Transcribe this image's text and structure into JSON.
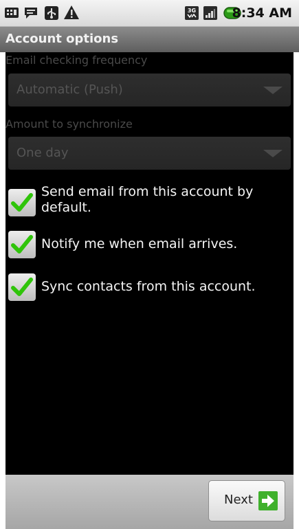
{
  "status_bar": {
    "time": "8:34 AM",
    "left_icons": [
      "keyboard-icon",
      "message-icon",
      "usb-icon",
      "warning-icon"
    ],
    "right_icons": [
      "3g-icon",
      "signal-icon",
      "battery-icon"
    ]
  },
  "title_bar": {
    "title": "Account options"
  },
  "settings": {
    "frequency": {
      "label": "Email checking frequency",
      "value": "Automatic (Push)"
    },
    "amount": {
      "label": "Amount to synchronize",
      "value": "One day"
    }
  },
  "checkboxes": [
    {
      "label_line1": "Send email from this account by",
      "label_line2": "default.",
      "checked": true
    },
    {
      "label_line1": "Notify me when email arrives.",
      "label_line2": "",
      "checked": true
    },
    {
      "label_line1": "Sync contacts from this account.",
      "label_line2": "",
      "checked": true
    }
  ],
  "bottom_bar": {
    "next_label": "Next"
  },
  "colors": {
    "check_green": "#2fc40a",
    "next_arrow_green": "#3fb12c",
    "content_bg": "#000000",
    "title_bar": "#6f6f6f"
  }
}
